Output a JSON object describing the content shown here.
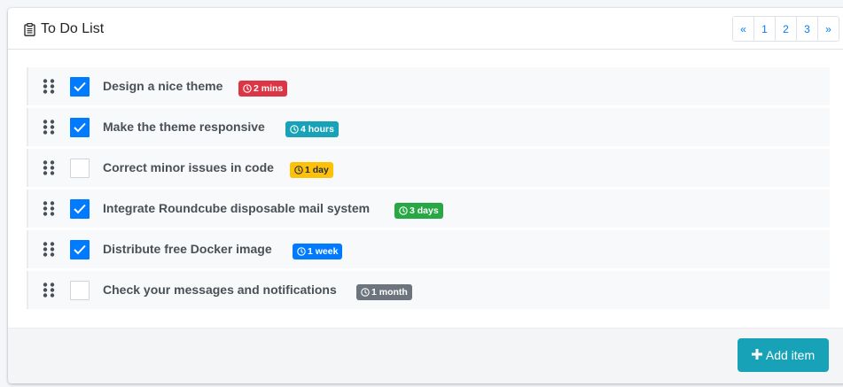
{
  "card": {
    "title": "To Do List",
    "title_icon": "clipboard-icon"
  },
  "pagination": [
    "«",
    "1",
    "2",
    "3",
    "»"
  ],
  "todos": [
    {
      "text": "Design a nice theme",
      "checked": true,
      "badge": "2 mins",
      "badge_color": "#dc3545",
      "badge_text_color": "#ffffff"
    },
    {
      "text": "Make the theme responsive",
      "checked": true,
      "badge": "4 hours",
      "badge_color": "#17a2b8",
      "badge_text_color": "#ffffff"
    },
    {
      "text": "Correct minor issues in code",
      "checked": false,
      "badge": "1 day",
      "badge_color": "#ffc107",
      "badge_text_color": "#1f2d3d"
    },
    {
      "text": "Integrate Roundcube disposable mail system",
      "checked": true,
      "badge": "3 days",
      "badge_color": "#28a745",
      "badge_text_color": "#ffffff"
    },
    {
      "text": "Distribute free Docker image",
      "checked": true,
      "badge": "1 week",
      "badge_color": "#007bff",
      "badge_text_color": "#ffffff"
    },
    {
      "text": "Check your messages and notifications",
      "checked": false,
      "badge": "1 month",
      "badge_color": "#6c757d",
      "badge_text_color": "#ffffff"
    }
  ],
  "footer": {
    "add_label": "Add item",
    "add_color": "#17a2b8"
  }
}
